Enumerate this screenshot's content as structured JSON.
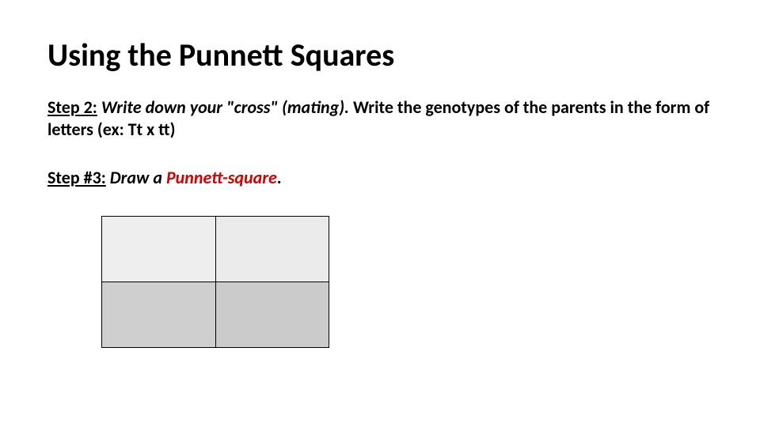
{
  "title": "Using the Punnett Squares",
  "step2": {
    "label": "Step 2:",
    "italic_lead": " Write down your \"cross\" (mating).",
    "trailing": "  Write the genotypes of the parents in the form of letters (ex: Tt x tt)"
  },
  "step3": {
    "label": "Step #3:",
    "italic_plain": " Draw a ",
    "italic_red": "Punnett-square",
    "period": "."
  },
  "punnett": {
    "rows": 2,
    "cols": 2,
    "cell_colors": [
      "#eeeeee",
      "#ebebeb",
      "#cfcfcf",
      "#cbcbcb"
    ]
  }
}
